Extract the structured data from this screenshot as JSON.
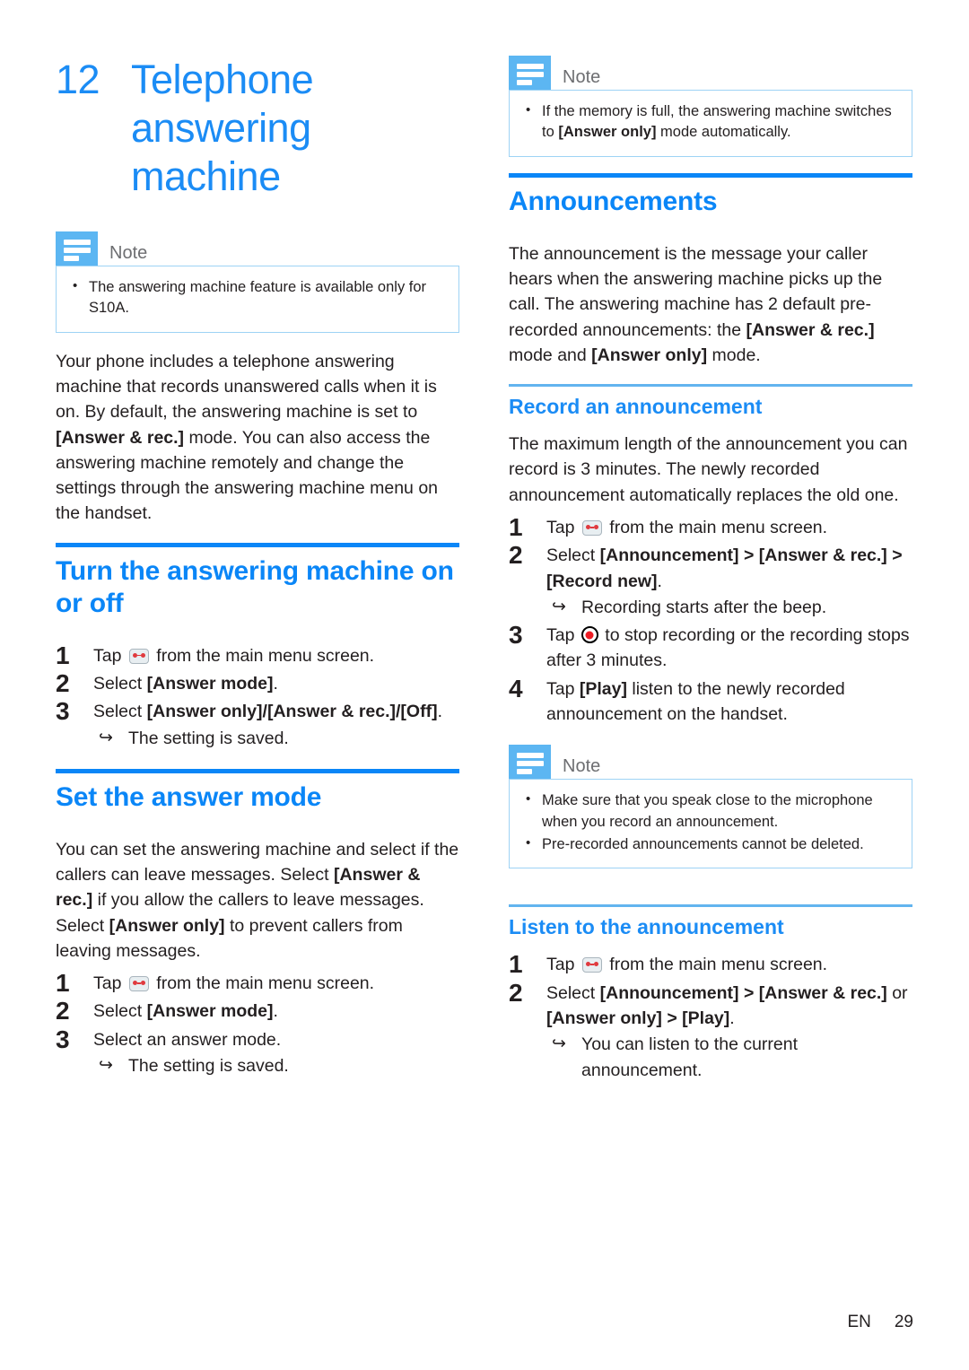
{
  "chapter": {
    "number": "12",
    "title": "Telephone answering machine"
  },
  "colors": {
    "heading_blue": "#0a86f7",
    "title_blue": "#1b8cf5",
    "note_icon_blue": "#5cb6f2",
    "note_border_blue": "#9ed3f5",
    "record_red": "#ed1c24"
  },
  "left_column": {
    "note": {
      "label": "Note",
      "items": [
        "The answering machine feature is available only for S10A."
      ]
    },
    "intro_paragraph_1": "Your phone includes a telephone answering machine that records unanswered calls when it is on. By default, the answering machine is set to ",
    "intro_bold_1": "[Answer & rec.]",
    "intro_paragraph_2": " mode. You can also access the answering machine remotely and change the settings through the answering machine menu on the handset.",
    "section_turn": {
      "heading": "Turn the answering machine on or off",
      "steps": [
        {
          "num": "1",
          "pre": "Tap ",
          "icon": "answering-machine-icon",
          "post": " from the main menu screen."
        },
        {
          "num": "2",
          "pre": "Select ",
          "bold": "[Answer mode]",
          "post": "."
        },
        {
          "num": "3",
          "pre": "Select ",
          "bold": "[Answer only]/[Answer & rec.]/[Off]",
          "post": ".",
          "sub": "The setting is saved."
        }
      ]
    },
    "section_set_mode": {
      "heading": "Set the answer mode",
      "paragraph_1": "You can set the answering machine and select if the callers can leave messages. Select ",
      "bold_1": "[Answer & rec.]",
      "paragraph_2": " if you allow the callers to leave messages. Select ",
      "bold_2": "[Answer only]",
      "paragraph_3": " to prevent callers from leaving messages.",
      "steps": [
        {
          "num": "1",
          "pre": "Tap ",
          "icon": "answering-machine-icon",
          "post": " from the main menu screen."
        },
        {
          "num": "2",
          "pre": "Select ",
          "bold": "[Answer mode]",
          "post": "."
        },
        {
          "num": "3",
          "pre": "Select an answer mode.",
          "sub": "The setting is saved."
        }
      ]
    }
  },
  "right_column": {
    "note_top": {
      "label": "Note",
      "item_pre": "If the memory is full, the answering machine switches to ",
      "item_bold": "[Answer only]",
      "item_post": " mode automatically."
    },
    "section_announcements": {
      "heading": "Announcements",
      "paragraph_1": "The announcement is the message your caller hears when the answering machine picks up the call. The answering machine has 2 default pre-recorded announcements: the ",
      "bold_1": "[Answer & rec.]",
      "paragraph_2": " mode and ",
      "bold_2": "[Answer only]",
      "paragraph_3": " mode."
    },
    "section_record": {
      "heading": "Record an announcement",
      "paragraph": "The maximum length of the announcement you can record is 3 minutes. The newly recorded announcement automatically replaces the old one.",
      "steps": [
        {
          "num": "1",
          "pre": "Tap ",
          "icon": "answering-machine-icon",
          "post": " from the main menu screen."
        },
        {
          "num": "2",
          "pre": "Select ",
          "bold": "[Announcement] > [Answer & rec.] > [Record new]",
          "post": ".",
          "sub": "Recording starts after the beep."
        },
        {
          "num": "3",
          "pre": "Tap ",
          "icon": "record-icon",
          "post": " to stop recording or the recording stops after 3 minutes."
        },
        {
          "num": "4",
          "pre": "Tap ",
          "bold": "[Play]",
          "post": " listen to the newly recorded announcement on the handset."
        }
      ]
    },
    "note_bottom": {
      "label": "Note",
      "items": [
        "Make sure that you speak close to the microphone when you record an announcement.",
        "Pre-recorded announcements cannot be deleted."
      ]
    },
    "section_listen": {
      "heading": "Listen to the announcement",
      "steps": [
        {
          "num": "1",
          "pre": "Tap ",
          "icon": "answering-machine-icon",
          "post": " from the main menu screen."
        },
        {
          "num": "2",
          "pre": "Select ",
          "bold_1": "[Announcement] > [Answer & rec.]",
          "mid": " or ",
          "bold_2": "[Answer only] > [Play]",
          "post": ".",
          "sub": "You can listen to the current announcement."
        }
      ]
    }
  },
  "footer": {
    "language": "EN",
    "page_number": "29"
  }
}
